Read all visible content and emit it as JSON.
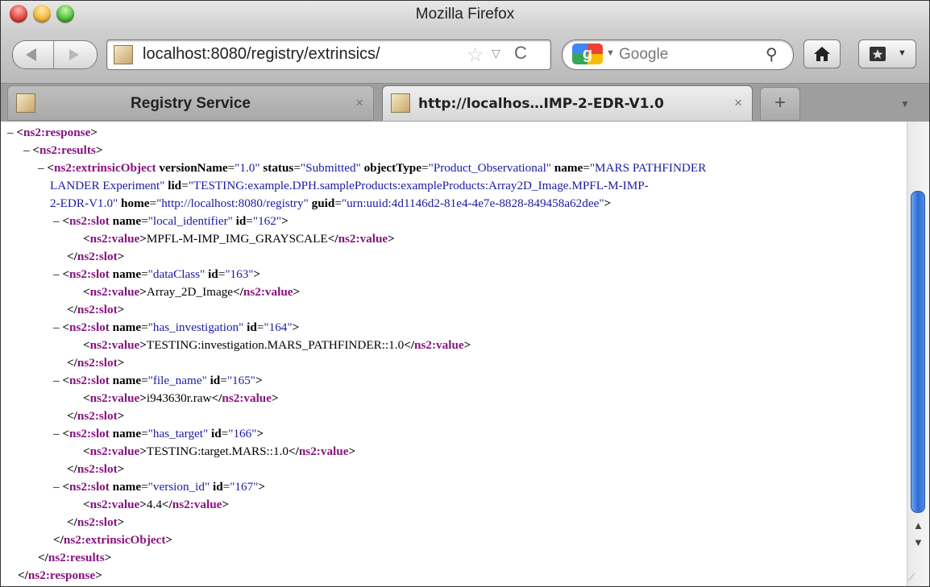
{
  "window": {
    "title": "Mozilla Firefox"
  },
  "toolbar": {
    "url": "localhost:8080/registry/extrinsics/",
    "search_placeholder": "Google",
    "star_glyph": "☆",
    "drop_glyph": "▽",
    "reload_glyph": "C"
  },
  "tabs": [
    {
      "label": "Registry Service",
      "close": "×"
    },
    {
      "label": "http://localhos…IMP-2-EDR-V1.0",
      "close": "×"
    }
  ],
  "newtab_label": "+",
  "xml": {
    "response_open": {
      "dash": "–",
      "tag": "ns2:response"
    },
    "results_open": {
      "dash": "–",
      "tag": "ns2:results"
    },
    "extrinsic": {
      "dash": "–",
      "tag": "ns2:extrinsicObject",
      "versionName_attr": "versionName",
      "versionName_val": "\"1.0\"",
      "status_attr": "status",
      "status_val": "\"Submitted\"",
      "objectType_attr": "objectType",
      "objectType_val": "\"Product_Observational\"",
      "name_attr": "name",
      "name_val_1": "\"MARS PATHFINDER",
      "name_val_2": "LANDER Experiment\"",
      "lid_attr": "lid",
      "lid_val_1": "\"TESTING:example.DPH.sampleProducts:exampleProducts:Array2D_Image.MPFL-M-IMP-",
      "lid_val_2": "2-EDR-V1.0\"",
      "home_attr": "home",
      "home_val": "\"http://localhost:8080/registry\"",
      "guid_attr": "guid",
      "guid_val": "\"urn:uuid:4d1146d2-81e4-4e7e-8828-849458a62dee\""
    },
    "slots": [
      {
        "name": "\"local_identifier\"",
        "id": "\"162\"",
        "value": "MPFL-M-IMP_IMG_GRAYSCALE"
      },
      {
        "name": "\"dataClass\"",
        "id": "\"163\"",
        "value": "Array_2D_Image"
      },
      {
        "name": "\"has_investigation\"",
        "id": "\"164\"",
        "value": "TESTING:investigation.MARS_PATHFINDER::1.0"
      },
      {
        "name": "\"file_name\"",
        "id": "\"165\"",
        "value": "i943630r.raw"
      },
      {
        "name": "\"has_target\"",
        "id": "\"166\"",
        "value": "TESTING:target.MARS::1.0"
      },
      {
        "name": "\"version_id\"",
        "id": "\"167\"",
        "value": "4.4"
      }
    ],
    "slot_tag": "ns2:slot",
    "value_tag": "ns2:value",
    "slot_dash": "–",
    "name_attr": "name",
    "id_attr": "id",
    "extrinsic_close": "ns2:extrinsicObject",
    "results_close": "ns2:results",
    "response_close": "ns2:response"
  },
  "colors": {
    "element": "#881280",
    "attr_value": "#1a1aa6",
    "scroll_thumb": "#2f6cd3"
  }
}
